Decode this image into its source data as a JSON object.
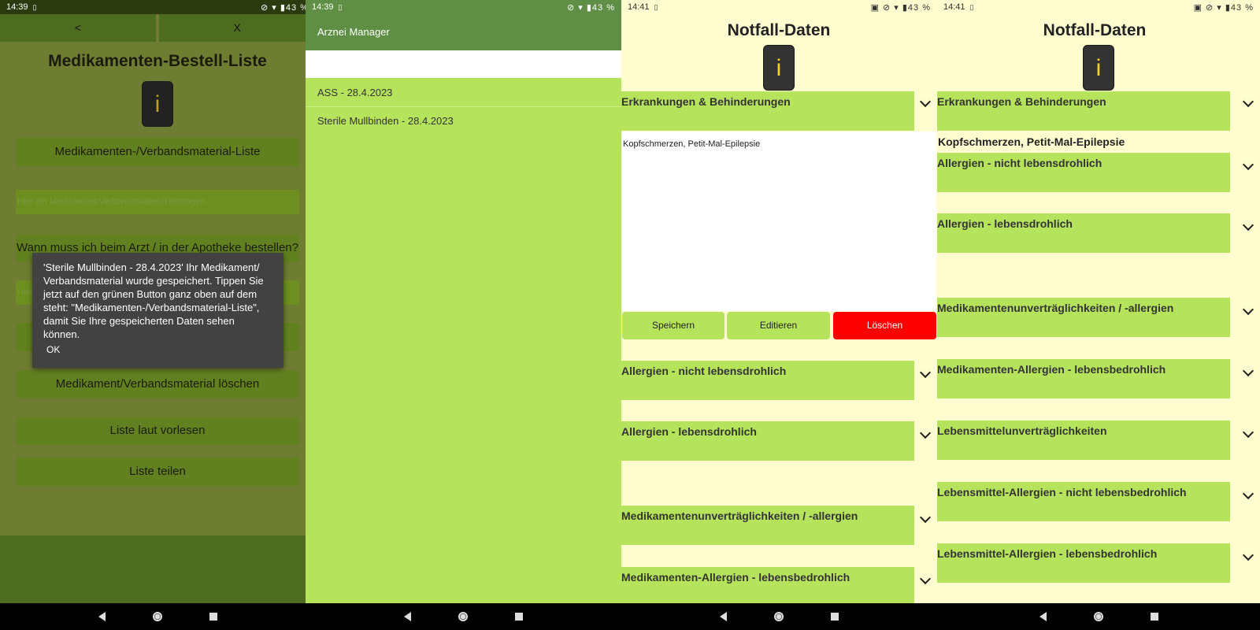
{
  "screen1": {
    "status": {
      "time": "14:39",
      "notif": "▯",
      "icons": "⊘ ▾ ▮43 %"
    },
    "back_label": "<",
    "close_label": "X",
    "title": "Medikamenten-Bestell-Liste",
    "info_label": "i",
    "list_button": "Medikamenten-/Verbandsmaterial-Liste",
    "input_placeholder": "Hier ein Medikament/Verbandsmaterial eintragen",
    "question_button": "Wann muss ich beim Arzt / in der Apotheke bestellen?",
    "second_input_placeholder": "Hier",
    "delete_button": "Medikament/Verbandsmaterial löschen",
    "read_button": "Liste laut vorlesen",
    "share_button": "Liste teilen",
    "dialog": {
      "message": "'Sterile Mullbinden - 28.4.2023' Ihr Medikament/ Verbandsmaterial wurde gespeichert. Tippen Sie jetzt auf den grünen Button ganz oben auf dem steht: \"Medikamenten-/Verbandsmaterial-Liste\", damit Sie Ihre gespeicherten Daten sehen können.",
      "ok_label": "OK"
    }
  },
  "screen2": {
    "status": {
      "time": "14:39",
      "notif": "▯",
      "icons": "⊘ ▾ ▮43 %"
    },
    "app_title": "Arznei Manager",
    "items": [
      "ASS - 28.4.2023",
      "Sterile Mullbinden - 28.4.2023"
    ]
  },
  "screen3": {
    "status": {
      "time": "14:41",
      "notif": "▯",
      "icons": "▣ ⊘ ▾ ▮43 %"
    },
    "title": "Notfall-Daten",
    "info_label": "i",
    "categories": [
      "Erkrankungen & Behinderungen",
      "Allergien - nicht lebensdrohlich",
      "Allergien - lebensdrohlich",
      "Medikamentenunverträglichkeiten / -allergien",
      "Medikamenten-Allergien - lebensbedrohlich"
    ],
    "textarea_value": "Kopfschmerzen, Petit-Mal-Epilepsie",
    "save_label": "Speichern",
    "edit_label": "Editieren",
    "delete_label": "Löschen"
  },
  "screen4": {
    "status": {
      "time": "14:41",
      "notif": "▯",
      "icons": "▣ ⊘ ▾ ▮43 %"
    },
    "title": "Notfall-Daten",
    "info_label": "i",
    "first_category": "Erkrankungen & Behinderungen",
    "saved_text": "Kopfschmerzen, Petit-Mal-Epilepsie",
    "categories": [
      "Allergien - nicht lebensdrohlich",
      "Allergien - lebensdrohlich",
      "Medikamentenunverträglichkeiten / -allergien",
      "Medikamenten-Allergien - lebensbedrohlich",
      "Lebensmittelunverträglichkeiten",
      "Lebensmittel-Allergien - nicht lebensbedrohlich",
      "Lebensmittel-Allergien - lebensbedrohlich"
    ]
  },
  "colors": {
    "accent_green": "#b5e35c",
    "danger": "#ff0000",
    "appbar": "#5e8f45",
    "background_cream": "#fffdcf"
  }
}
